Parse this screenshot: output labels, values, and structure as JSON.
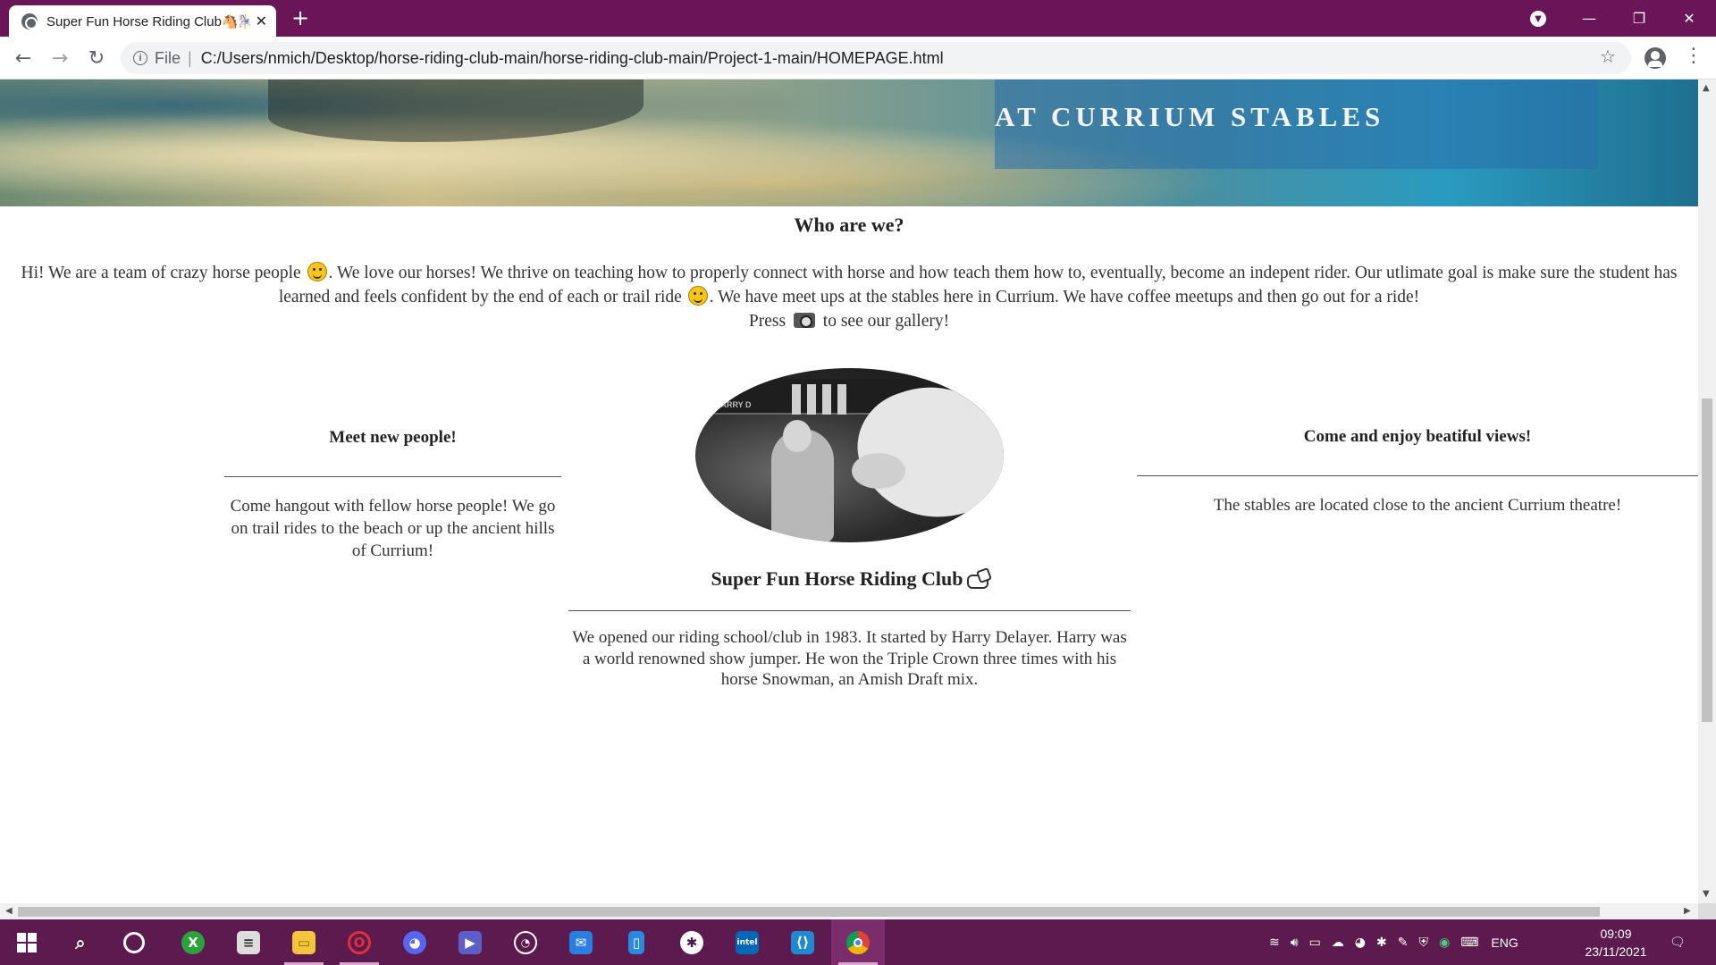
{
  "browser": {
    "tab_title": "Super Fun Horse Riding Club🐴🎠",
    "tab_close": "✕",
    "new_tab": "+",
    "file_label": "File",
    "separator": "|",
    "url": "C:/Users/nmich/Desktop/horse-riding-club-main/horse-riding-club-main/Project-1-main/HOMEPAGE.html",
    "window_controls": {
      "minimize": "—",
      "maximize": "❐",
      "close": "✕"
    }
  },
  "page": {
    "hero_text": "AT CURRIUM STABLES",
    "who_title": "Who are we?",
    "intro": {
      "part1": "Hi! We are a team of crazy horse people ",
      "part2": ". We love our horses! We thrive on teaching how to properly connect with horse and how teach them how to, eventually, become an indepent rider. Our utlimate goal is make sure the student has learned and feels confident by the end of each or trail ride ",
      "part3": ". We have meet ups at the stables here in Currium. We have coffee meetups and then go out for a ride!",
      "press": "Press ",
      "press_after": " to see our gallery!"
    },
    "left": {
      "heading": "Meet new people!",
      "text": "Come hangout with fellow horse people! We go on trail rides to the beach or up the ancient hills of Currium!"
    },
    "middle": {
      "photo_banner_text": "HARRY D",
      "heading": "Super Fun Horse Riding Club",
      "text": "We opened our riding school/club in 1983. It started by Harry Delayer. Harry was a world renowned show jumper. He won the Triple Crown three times with his horse Snowman, an Amish Draft mix."
    },
    "right": {
      "heading": "Come and enjoy beatiful views!",
      "text": "The stables are located close to the ancient Currium theatre!"
    }
  },
  "taskbar": {
    "apps": [
      "windows-start",
      "search",
      "cortana",
      "xbox",
      "stack",
      "file-explorer",
      "opera",
      "discord",
      "power-automate",
      "speedometer",
      "mail",
      "notepad",
      "slack",
      "intel",
      "vscode",
      "chrome"
    ],
    "intel_label": "intel",
    "lang": "ENG",
    "time": "09:09",
    "date": "23/11/2021"
  },
  "colors": {
    "titlebar": "#6b1559",
    "taskbar": "#5c1a4f"
  }
}
